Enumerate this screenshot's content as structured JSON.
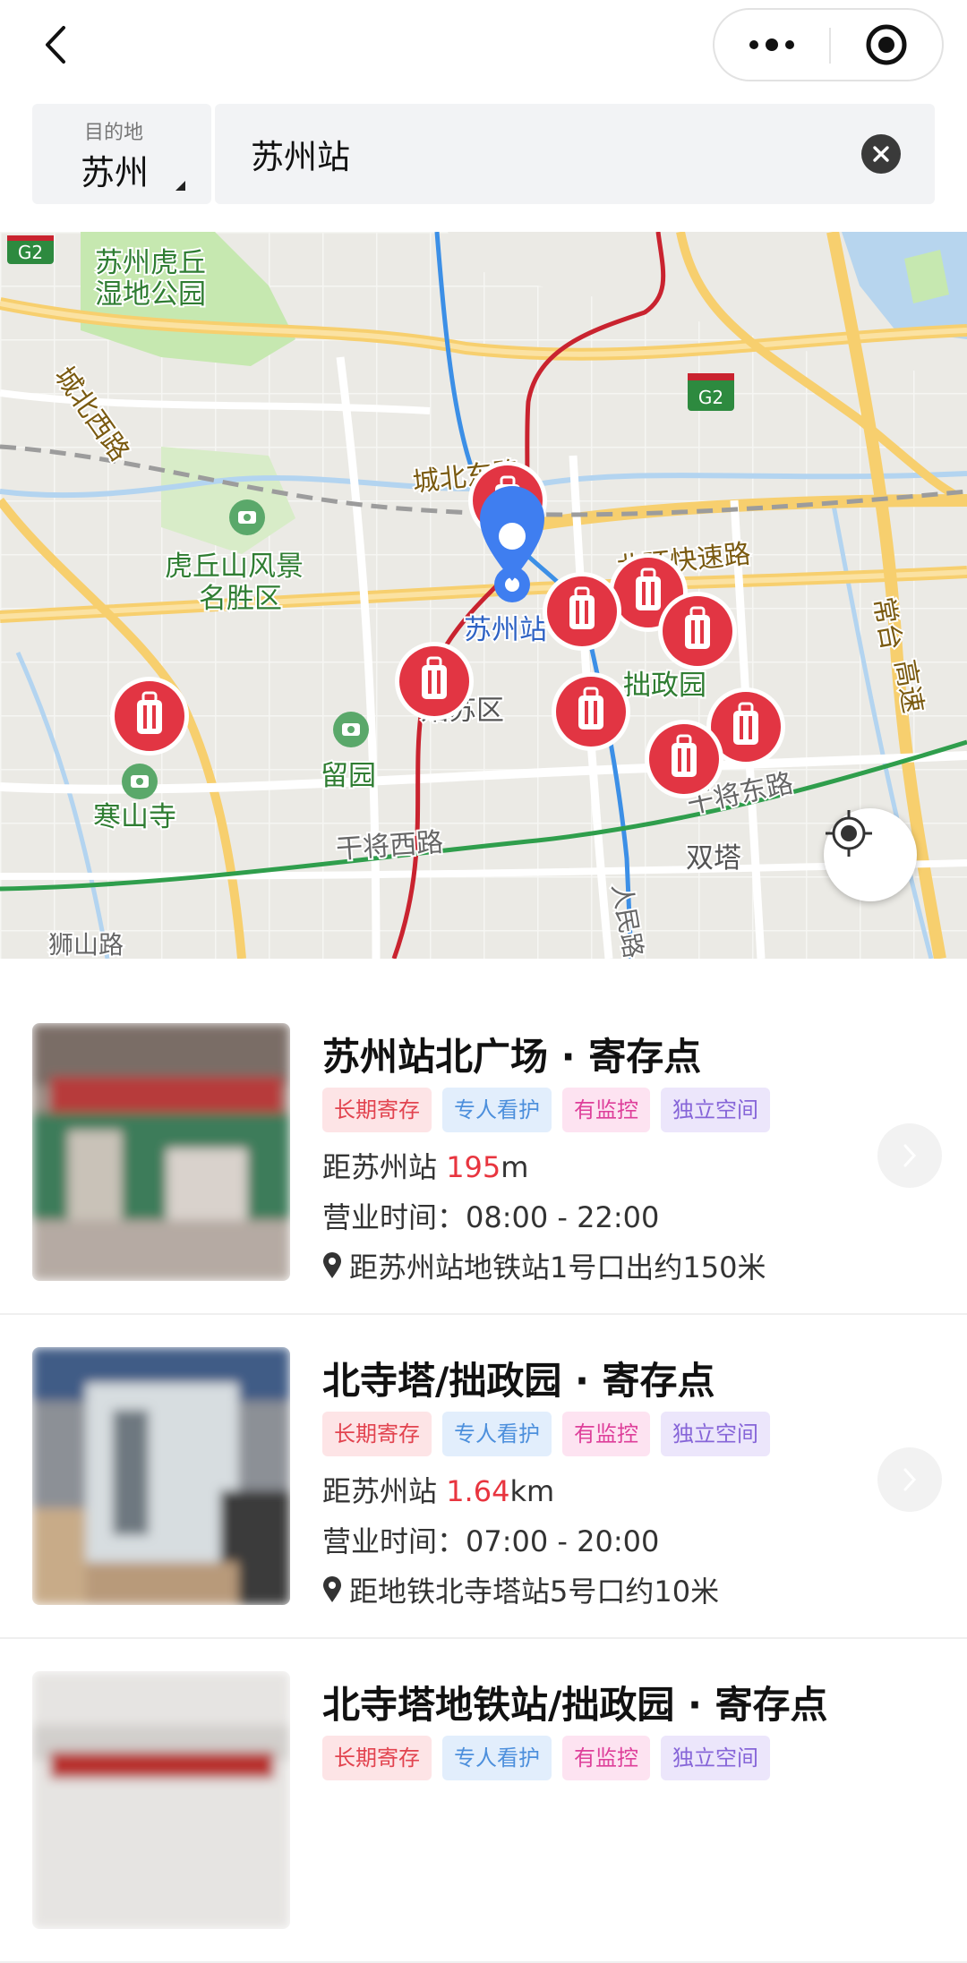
{
  "nav": {
    "back_icon": "chevron-left-icon",
    "more_icon": "more-dots-icon",
    "target_icon": "target-icon"
  },
  "destination": {
    "label": "目的地",
    "city": "苏州"
  },
  "search": {
    "value": "苏州站"
  },
  "map": {
    "labels": {
      "huqiu_park_1": "苏州虎丘",
      "huqiu_park_2": "湿地公园",
      "chengbei_west": "城北西路",
      "chengbei_east": "城北东路",
      "huqiushan_1": "虎丘山风景",
      "huqiushan_2": "名胜区",
      "north_ring": "北环快速路",
      "suzhou_station": "苏州站",
      "zhuozheng": "拙政园",
      "gusu": "姑苏区",
      "liuyuan": "留园",
      "hanshansi": "寒山寺",
      "ganjiang_west": "干将西路",
      "ganjiang_east": "干将东路",
      "shuangta": "双塔",
      "changtai_1": "常台",
      "changtai_2": "高速",
      "renmin": "人民路",
      "shishan": "狮山路",
      "g2": "G2"
    }
  },
  "cards": [
    {
      "title": "苏州站北广场 · 寄存点",
      "tags": [
        "长期寄存",
        "专人看护",
        "有监控",
        "独立空间"
      ],
      "dist_prefix": "距苏州站 ",
      "dist_value": "195",
      "dist_unit": "m",
      "hours": "营业时间：08:00 - 22:00",
      "address": "距苏州站地铁站1号口出约150米"
    },
    {
      "title": "北寺塔/拙政园 · 寄存点",
      "tags": [
        "长期寄存",
        "专人看护",
        "有监控",
        "独立空间"
      ],
      "dist_prefix": "距苏州站 ",
      "dist_value": "1.64",
      "dist_unit": "km",
      "hours": "营业时间：07:00 - 20:00",
      "address": "距地铁北寺塔站5号口约10米"
    },
    {
      "title": "北寺塔地铁站/拙政园 · 寄存点",
      "tags": [
        "长期寄存",
        "专人看护",
        "有监控",
        "独立空间"
      ]
    }
  ],
  "colors": {
    "accent_red": "#e8353f",
    "pin_blue": "#3f7ef0",
    "metro_blue": "#3c8fe6",
    "metro_red": "#c9232f",
    "metro_green": "#2f9e4c"
  }
}
